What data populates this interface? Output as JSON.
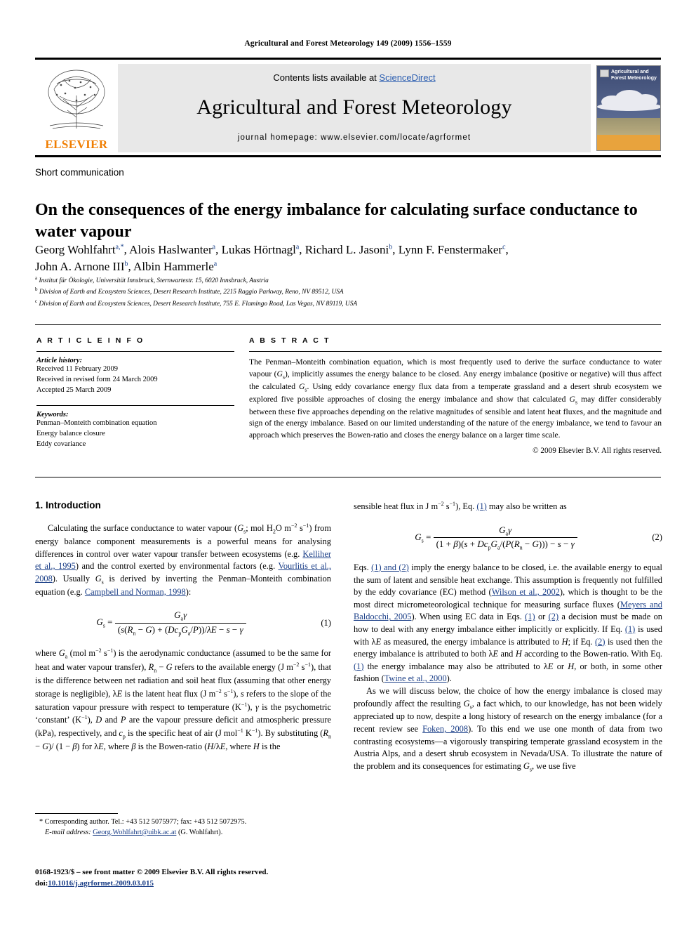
{
  "running_head": "Agricultural and Forest Meteorology 149 (2009) 1556–1559",
  "masthead": {
    "contents_prefix": "Contents lists available at ",
    "sciencedirect": "ScienceDirect",
    "journal_title": "Agricultural and Forest Meteorology",
    "homepage": "journal homepage: www.elsevier.com/locate/agrformet",
    "publisher": "ELSEVIER",
    "cover_title": "Agricultural and Forest Meteorology"
  },
  "article": {
    "type": "Short communication",
    "title": "On the consequences of the energy imbalance for calculating surface conductance to water vapour",
    "authors": "Georg Wohlfahrt a,*, Alois Haslwanter a, Lukas Hörtnagl a, Richard L. Jasoni b, Lynn F. Fenstermaker c, John A. Arnone III b, Albin Hammerle a",
    "affiliations": [
      "Institut für Ökologie, Universität Innsbruck, Sternwartestr. 15, 6020 Innsbruck, Austria",
      "Division of Earth and Ecosystem Sciences, Desert Research Institute, 2215 Raggio Parkway, Reno, NV 89512, USA",
      "Division of Earth and Ecosystem Sciences, Desert Research Institute, 755 E. Flamingo Road, Las Vegas, NV 89119, USA"
    ]
  },
  "article_info": {
    "heading": "A R T I C L E  I N F O",
    "history_label": "Article history:",
    "history": [
      "Received 11 February 2009",
      "Received in revised form 24 March 2009",
      "Accepted 25 March 2009"
    ],
    "keywords_label": "Keywords:",
    "keywords": [
      "Penman–Monteith combination equation",
      "Energy balance closure",
      "Eddy covariance"
    ]
  },
  "abstract": {
    "heading": "A B S T R A C T",
    "text": "The Penman–Monteith combination equation, which is most frequently used to derive the surface conductance to water vapour (Gs), implicitly assumes the energy balance to be closed. Any energy imbalance (positive or negative) will thus affect the calculated Gs. Using eddy covariance energy flux data from a temperate grassland and a desert shrub ecosystem we explored five possible approaches of closing the energy imbalance and show that calculated Gs may differ considerably between these five approaches depending on the relative magnitudes of sensible and latent heat fluxes, and the magnitude and sign of the energy imbalance. Based on our limited understanding of the nature of the energy imbalance, we tend to favour an approach which preserves the Bowen-ratio and closes the energy balance on a larger time scale.",
    "copyright": "© 2009 Elsevier B.V. All rights reserved."
  },
  "body": {
    "section1_heading": "1. Introduction",
    "para1": "Calculating the surface conductance to water vapour (Gs; mol H2O m−2 s−1) from energy balance component measurements is a powerful means for analysing differences in control over water vapour transfer between ecosystems (e.g. Kelliher et al., 1995) and the control exerted by environmental factors (e.g. Vourlitis et al., 2008). Usually Gs is derived by inverting the Penman–Monteith combination equation (e.g. Campbell and Norman, 1998):",
    "eq1_number": "(1)",
    "eq1_latex": "Gs = Gaγ / ((s(Rn − G) + (DcpGa/P))/λE − s − γ)",
    "para2": "where Ga (mol m−2 s−1) is the aerodynamic conductance (assumed to be the same for heat and water vapour transfer), Rn − G refers to the available energy (J m−2 s−1), that is the difference between net radiation and soil heat flux (assuming that other energy storage is negligible), λE is the latent heat flux (J m−2 s−1), s refers to the slope of the saturation vapour pressure with respect to temperature (K−1), γ is the psychometric ‘constant’ (K−1), D and P are the vapour pressure deficit and atmospheric pressure (kPa), respectively, and cp is the specific heat of air (J mol−1 K−1). By substituting (Rn − G)/(1 − β) for λE, where β is the Bowen-ratio (H/λE, where H is the",
    "para3_cont": "sensible heat flux in J m−2 s−1), Eq. (1) may also be written as",
    "eq2_number": "(2)",
    "eq2_latex": "Gs = Gaγ / ((1 + β)(s + DcpGa/(P(Rn − G))) − s − γ)",
    "para4": "Eqs. (1) and (2) imply the energy balance to be closed, i.e. the available energy to equal the sum of latent and sensible heat exchange. This assumption is frequently not fulfilled by the eddy covariance (EC) method (Wilson et al., 2002), which is thought to be the most direct micrometeorological technique for measuring surface fluxes (Meyers and Baldocchi, 2005). When using EC data in Eqs. (1) or (2) a decision must be made on how to deal with any energy imbalance either implicitly or explicitly. If Eq. (1) is used with λE as measured, the energy imbalance is attributed to H; if Eq. (2) is used then the energy imbalance is attributed to both λE and H according to the Bowen-ratio. With Eq. (1) the energy imbalance may also be attributed to λE or H, or both, in some other fashion (Twine et al., 2000).",
    "para5": "As we will discuss below, the choice of how the energy imbalance is closed may profoundly affect the resulting Gs, a fact which, to our knowledge, has not been widely appreciated up to now, despite a long history of research on the energy imbalance (for a recent review see Foken, 2008). To this end we use one month of data from two contrasting ecosystems—a vigorously transpiring temperate grassland ecosystem in the Austria Alps, and a desert shrub ecosystem in Nevada/USA. To illustrate the nature of the problem and its consequences for estimating Gs, we use five"
  },
  "footnote": {
    "corresponding": "* Corresponding author. Tel.: +43 512 5075977; fax: +43 512 5072975.",
    "email_label": "E-mail address:",
    "email": "Georg.Wohlfahrt@uibk.ac.at",
    "email_suffix": "(G. Wohlfahrt)."
  },
  "footer": {
    "issn_line": "0168-1923/$ – see front matter © 2009 Elsevier B.V. All rights reserved.",
    "doi_label": "doi:",
    "doi": "10.1016/j.agrformet.2009.03.015"
  },
  "colors": {
    "link": "#1a3e87",
    "elsevier_orange": "#f07d00",
    "panel_grey": "#e8e8e8"
  }
}
